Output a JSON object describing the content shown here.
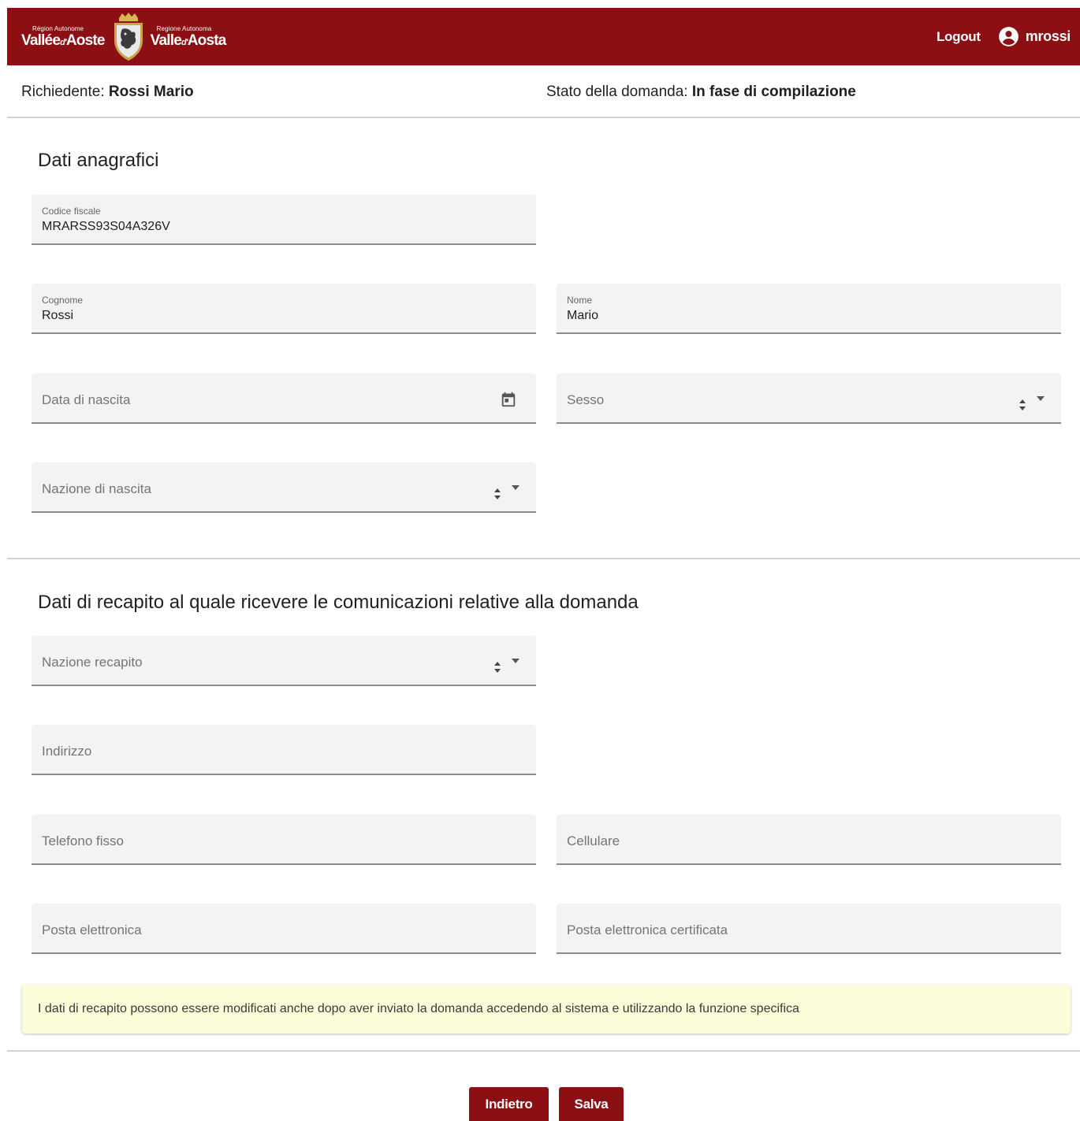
{
  "header": {
    "logo_left_small": "Région Autonome",
    "logo_left_big": "Vallée",
    "logo_left_particle": "d'",
    "logo_left_big2": "Aoste",
    "logo_right_small": "Regione Autonoma",
    "logo_right_big": "Valle",
    "logo_right_particle": "d'",
    "logo_right_big2": "Aosta",
    "logout_label": "Logout",
    "username": "mrossi",
    "background_color": "#8b0f13"
  },
  "infobar": {
    "applicant_label": "Richiedente:",
    "applicant_value": "Rossi Mario",
    "status_label": "Stato della domanda:",
    "status_value": "In fase di compilazione"
  },
  "personal_section": {
    "title": "Dati anagrafici",
    "fiscal_code": {
      "label": "Codice fiscale",
      "value": "MRARSS93S04A326V"
    },
    "surname": {
      "label": "Cognome",
      "value": "Rossi"
    },
    "name": {
      "label": "Nome",
      "value": "Mario"
    },
    "birth_date": {
      "placeholder": "Data di nascita",
      "icon": "calendar-icon"
    },
    "sex": {
      "placeholder": "Sesso"
    },
    "birth_country": {
      "placeholder": "Nazione di nascita"
    }
  },
  "contact_section": {
    "title": "Dati di recapito al quale ricevere le comunicazioni relative alla domanda",
    "country": {
      "placeholder": "Nazione recapito"
    },
    "address": {
      "placeholder": "Indirizzo"
    },
    "landline": {
      "placeholder": "Telefono fisso"
    },
    "mobile": {
      "placeholder": "Cellulare"
    },
    "email": {
      "placeholder": "Posta elettronica"
    },
    "pec": {
      "placeholder": "Posta elettronica certificata"
    },
    "notice": "I dati di recapito possono essere modificati anche dopo aver inviato la domanda accedendo al sistema e utilizzando la funzione specifica"
  },
  "actions": {
    "back_label": "Indietro",
    "save_label": "Salva",
    "button_color": "#8b0f13"
  }
}
